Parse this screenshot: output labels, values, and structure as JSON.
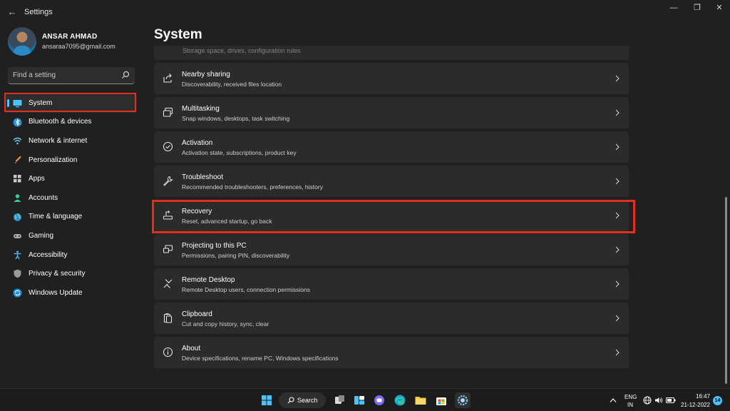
{
  "window": {
    "title": "Settings",
    "back_glyph": "←",
    "minimize_glyph": "—",
    "maximize_glyph": "❐",
    "close_glyph": "✕"
  },
  "user": {
    "name": "ANSAR AHMAD",
    "email": "ansaraa7095@gmail.com"
  },
  "search": {
    "placeholder": "Find a setting",
    "icon": "search-icon"
  },
  "sidebar": {
    "items": [
      {
        "label": "System",
        "icon": "monitor-icon",
        "active": true
      },
      {
        "label": "Bluetooth & devices",
        "icon": "bluetooth-icon"
      },
      {
        "label": "Network & internet",
        "icon": "wifi-icon"
      },
      {
        "label": "Personalization",
        "icon": "brush-icon"
      },
      {
        "label": "Apps",
        "icon": "apps-icon"
      },
      {
        "label": "Accounts",
        "icon": "person-icon"
      },
      {
        "label": "Time & language",
        "icon": "globe-icon"
      },
      {
        "label": "Gaming",
        "icon": "gamepad-icon"
      },
      {
        "label": "Accessibility",
        "icon": "accessibility-icon"
      },
      {
        "label": "Privacy & security",
        "icon": "shield-icon"
      },
      {
        "label": "Windows Update",
        "icon": "update-icon"
      }
    ]
  },
  "main": {
    "title": "System",
    "partial_subtitle": "Storage space, drives, configuration rules",
    "cards": [
      {
        "title": "Nearby sharing",
        "subtitle": "Discoverability, received files location",
        "icon": "share-icon"
      },
      {
        "title": "Multitasking",
        "subtitle": "Snap windows, desktops, task switching",
        "icon": "multitask-icon"
      },
      {
        "title": "Activation",
        "subtitle": "Activation state, subscriptions, product key",
        "icon": "check-circle-icon"
      },
      {
        "title": "Troubleshoot",
        "subtitle": "Recommended troubleshooters, preferences, history",
        "icon": "wrench-icon"
      },
      {
        "title": "Recovery",
        "subtitle": "Reset, advanced startup, go back",
        "icon": "recovery-icon"
      },
      {
        "title": "Projecting to this PC",
        "subtitle": "Permissions, pairing PIN, discoverability",
        "icon": "projector-icon"
      },
      {
        "title": "Remote Desktop",
        "subtitle": "Remote Desktop users, connection permissions",
        "icon": "remote-icon"
      },
      {
        "title": "Clipboard",
        "subtitle": "Cut and copy history, sync, clear",
        "icon": "clipboard-icon"
      },
      {
        "title": "About",
        "subtitle": "Device specifications, rename PC, Windows specifications",
        "icon": "info-icon"
      }
    ]
  },
  "taskbar": {
    "search_label": "Search",
    "language_top": "ENG",
    "language_bottom": "IN",
    "time": "16:47",
    "date": "21-12-2022",
    "notification_count": "14"
  },
  "colors": {
    "accent": "#4cc2ff",
    "highlight_box": "#e0301e",
    "card_bg": "#2b2b2b",
    "window_bg": "#202020"
  }
}
